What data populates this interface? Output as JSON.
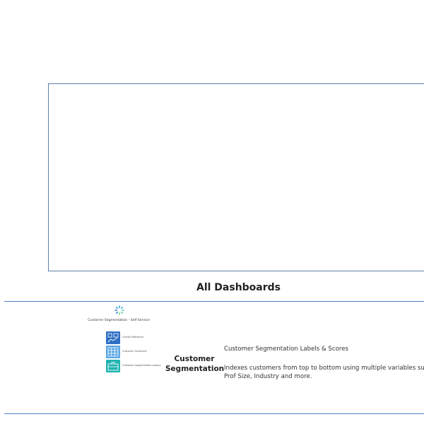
{
  "header": {
    "section_title": "All Dashboards"
  },
  "dashboards": [
    {
      "name_line1": "Customer",
      "name_line2": "Segmentation",
      "subtitle": "Customer Segmentation Labels & Scores",
      "description_line1": "Indexes customers from top to bottom using multiple variables suc",
      "description_line2": "Prof Size, Industry and more.",
      "thumbnail": {
        "title": "Customer Segmentation - Self Service",
        "logo_icon": "spinner-ring-icon",
        "items": [
          {
            "label": "Overall Reference",
            "icon": "chart-grid-icon",
            "color": "#2e6fc4"
          },
          {
            "label": "Customer Scorecard",
            "icon": "table-grid-icon",
            "color": "#5aa6e6"
          },
          {
            "label": "Customer Segmentation Lookup",
            "icon": "briefcase-icon",
            "color": "#1fb3b0"
          }
        ]
      }
    }
  ],
  "colors": {
    "rule": "#4a7fc7",
    "frame_border": "#5b7fa8"
  }
}
